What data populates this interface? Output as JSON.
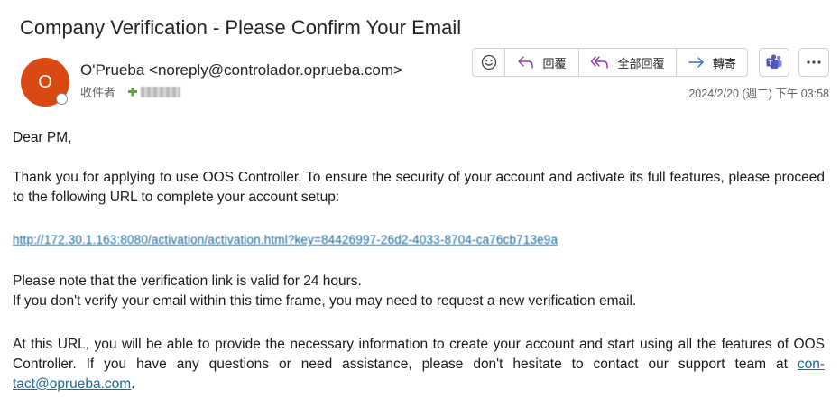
{
  "email": {
    "subject": "Company Verification - Please Confirm Your Email",
    "avatar_initial": "O",
    "sender": "O'Prueba <noreply@controlador.oprueba.com>",
    "to_label": "收件者",
    "date": "2024/2/20 (週二) 下午 03:58"
  },
  "toolbar": {
    "reply_label": "回覆",
    "reply_all_label": "全部回覆",
    "forward_label": "轉寄"
  },
  "body": {
    "greeting": "Dear PM,",
    "para1": "Thank you for applying to use OOS Controller. To ensure the security of your account and activate its full features, please proceed to the following URL to complete your account setup:",
    "link": "http://172.30.1.163:8080/activation/activation.html?key=84426997-26d2-4033-8704-ca76cb713e9a",
    "note1": "Please note that the verification link is valid for 24 hours.",
    "note2": "If you don't verify your email within this time frame, you may need to request a new verification email.",
    "para3_prefix": "At this URL, you will be able to provide the necessary information to create your account and start using all the features of OOS Controller. If you have any questions or need assistance, please don't hesitate to contact our support team at ",
    "contact_email": "con-tact@oprueba.com",
    "para3_suffix": "."
  },
  "colors": {
    "avatar": "#d84a12",
    "link": "#1b6a9a",
    "teams": "#5059c9",
    "reply_icon": "#8a3ea8",
    "forward_icon": "#2f6fd1"
  },
  "icons": {
    "emoji": "smiley-icon",
    "reply": "reply-arrow-icon",
    "reply_all": "reply-all-arrow-icon",
    "forward": "forward-arrow-icon",
    "teams": "teams-icon",
    "more": "more-dots-icon"
  }
}
